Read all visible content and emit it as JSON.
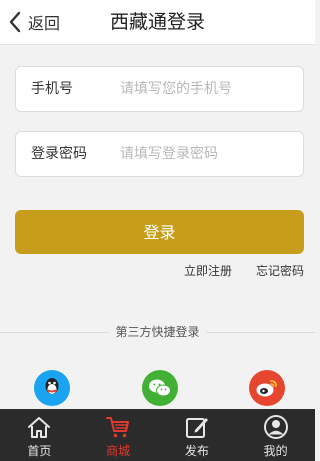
{
  "header": {
    "back_label": "返回",
    "title": "西藏通登录"
  },
  "form": {
    "phone": {
      "label": "手机号",
      "placeholder": "请填写您的手机号"
    },
    "password": {
      "label": "登录密码",
      "placeholder": "请填写登录密码"
    },
    "submit_label": "登录"
  },
  "links": {
    "register": "立即注册",
    "forgot": "忘记密码"
  },
  "third_party": {
    "title": "第三方快捷登录",
    "providers": [
      "qq-icon",
      "wechat-icon",
      "weibo-icon"
    ]
  },
  "tabbar": {
    "items": [
      {
        "label": "首页",
        "icon": "home-icon"
      },
      {
        "label": "商城",
        "icon": "cart-icon"
      },
      {
        "label": "发布",
        "icon": "edit-icon"
      },
      {
        "label": "我的",
        "icon": "user-icon"
      }
    ],
    "active_index": 1
  },
  "colors": {
    "accent": "#c79e1a",
    "active_tab": "#e03a2f",
    "tabbar_bg": "#2b2b2b",
    "qq": "#1aa3f0",
    "wechat": "#41b035",
    "weibo": "#e6452f"
  }
}
